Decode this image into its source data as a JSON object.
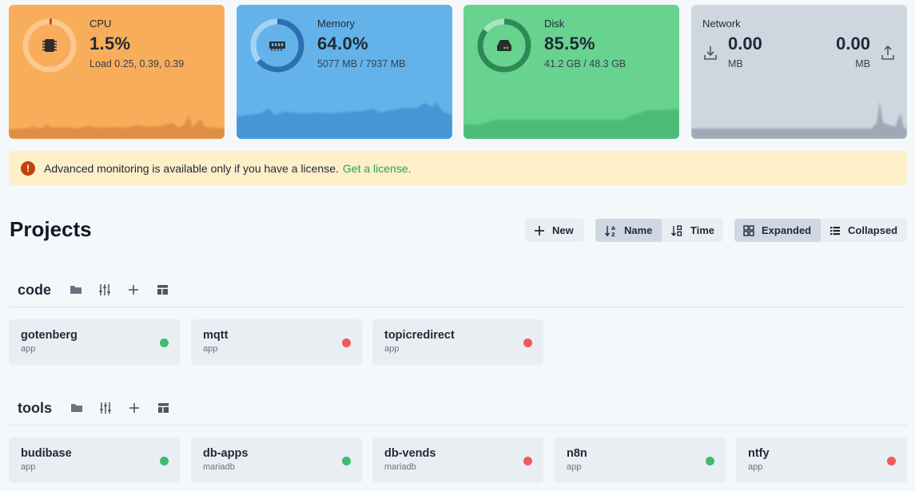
{
  "stats": {
    "cpu": {
      "label": "CPU",
      "value": "1.5%",
      "sub": "Load 0.25, 0.39, 0.39",
      "percent": 1.5,
      "icon": "cpu-chip-icon"
    },
    "memory": {
      "label": "Memory",
      "value": "64.0%",
      "sub": "5077 MB / 7937 MB",
      "percent": 64.0,
      "icon": "memory-icon"
    },
    "disk": {
      "label": "Disk",
      "value": "85.5%",
      "sub": "41.2 GB / 48.3 GB",
      "percent": 85.5,
      "icon": "hard-drive-icon"
    },
    "network": {
      "label": "Network",
      "download_value": "0.00",
      "download_unit": "MB",
      "upload_value": "0.00",
      "upload_unit": "MB"
    }
  },
  "banner": {
    "message": "Advanced monitoring is available only if you have a license.",
    "link": "Get a license."
  },
  "projects": {
    "title": "Projects",
    "new_label": "New",
    "sort": {
      "name_label": "Name",
      "time_label": "Time",
      "active": "Name"
    },
    "view": {
      "expanded_label": "Expanded",
      "collapsed_label": "Collapsed",
      "active": "Expanded"
    }
  },
  "groups": [
    {
      "name": "code",
      "items": [
        {
          "name": "gotenberg",
          "type": "app",
          "status": "running"
        },
        {
          "name": "mqtt",
          "type": "app",
          "status": "stopped"
        },
        {
          "name": "topicredirect",
          "type": "app",
          "status": "stopped"
        }
      ]
    },
    {
      "name": "tools",
      "items": [
        {
          "name": "budibase",
          "type": "app",
          "status": "running"
        },
        {
          "name": "db-apps",
          "type": "mariadb",
          "status": "running"
        },
        {
          "name": "db-vends",
          "type": "mariadb",
          "status": "stopped"
        },
        {
          "name": "n8n",
          "type": "app",
          "status": "running"
        },
        {
          "name": "ntfy",
          "type": "app",
          "status": "stopped"
        }
      ]
    }
  ],
  "colors": {
    "cpu_card": "#f8ad5b",
    "memory_card": "#63b3ea",
    "disk_card": "#68d28f",
    "network_card": "#ced7e0",
    "running": "#3fbb6e",
    "stopped": "#ee5b5b",
    "link": "#22a35a"
  }
}
